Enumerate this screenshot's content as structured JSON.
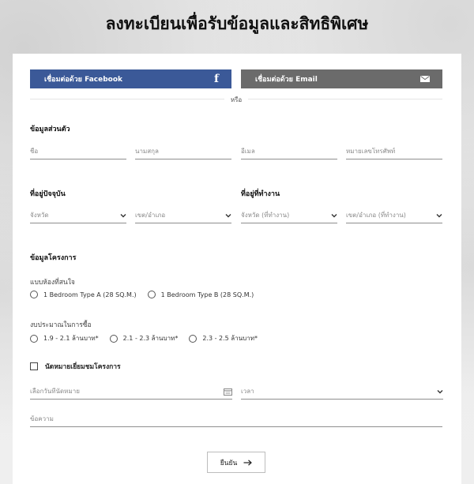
{
  "page": {
    "title": "ลงทะเบียนเพื่อรับข้อมูลและสิทธิพิเศษ"
  },
  "social": {
    "facebook_label": "เชื่อมต่อด้วย Facebook",
    "facebook_icon": "f",
    "email_label": "เชื่อมต่อด้วย Email",
    "divider": "หรือ",
    "facebook_color": "#3b5998",
    "email_color": "#6b6b6b"
  },
  "personal": {
    "heading": "ข้อมูลส่วนตัว",
    "first_name": {
      "placeholder": "ชื่อ",
      "value": ""
    },
    "last_name": {
      "placeholder": "นามสกุล",
      "value": ""
    },
    "email": {
      "placeholder": "อีเมล",
      "value": ""
    },
    "phone": {
      "placeholder": "หมายเลขโทรศัพท์",
      "value": ""
    }
  },
  "address": {
    "current_heading": "ที่อยู่ปัจจุบัน",
    "work_heading": "ที่อยู่ที่ทำงาน",
    "current_province": "จังหวัด",
    "current_district": "เขต/อำเภอ",
    "work_province": "จังหวัด (ที่ทำงาน)",
    "work_district": "เขต/อำเภอ (ที่ทำงาน)"
  },
  "project": {
    "heading": "ข้อมูลโครงการ",
    "room_label": "แบบห้องที่สนใจ",
    "room_options": [
      "1 Bedroom Type A (28 SQ.M.)",
      "1 Bedroom Type B (28 SQ.M.)"
    ],
    "budget_label": "งบประมาณในการซื้อ",
    "budget_options": [
      "1.9 - 2.1 ล้านบาท*",
      "2.1 - 2.3 ล้านบาท*",
      "2.3 - 2.5 ล้านบาท*"
    ]
  },
  "appointment": {
    "checkbox_label": "นัดหมายเยี่ยมชมโครงการ",
    "date_placeholder": "เลือกวันที่นัดหมาย",
    "time_label": "เวลา",
    "message_placeholder": "ข้อความ"
  },
  "submit": {
    "label": "ยืนยัน"
  }
}
